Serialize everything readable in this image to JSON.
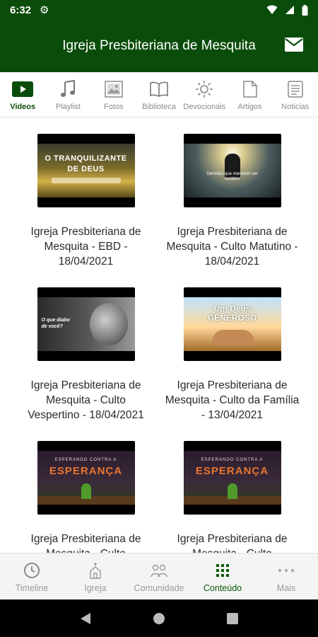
{
  "status_bar": {
    "time": "6:32"
  },
  "app_bar": {
    "title": "Igreja Presbiteriana de Mesquita"
  },
  "tabs": [
    {
      "label": "Videos",
      "icon": "play-icon",
      "active": true
    },
    {
      "label": "Playlist",
      "icon": "music-note-icon",
      "active": false
    },
    {
      "label": "Fotos",
      "icon": "image-icon",
      "active": false
    },
    {
      "label": "Biblioteca",
      "icon": "book-icon",
      "active": false
    },
    {
      "label": "Devocionais",
      "icon": "sun-icon",
      "active": false
    },
    {
      "label": "Artigos",
      "icon": "document-icon",
      "active": false
    },
    {
      "label": "Noticias",
      "icon": "news-icon",
      "active": false
    }
  ],
  "videos": [
    {
      "title": "Igreja Presbiteriana de Mesquita - EBD - 18/04/2021",
      "thumb_text": "O TRANQUILIZANTE DE DEUS"
    },
    {
      "title": "Igreja Presbiteriana de Mesquita - Culto Matutino - 18/04/2021",
      "thumb_text": "Gemidos que merecem ser ouvidos"
    },
    {
      "title": "Igreja Presbiteriana de Mesquita - Culto Vespertino - 18/04/2021",
      "thumb_text": "O que diabo de você?"
    },
    {
      "title": "Igreja Presbiteriana de Mesquita - Culto da Família - 13/04/2021",
      "thumb_text": "Um Deus GENEROSO"
    },
    {
      "title": "Igreja Presbiteriana de Mesquita - Culto",
      "thumb_text_top": "ESPERANDO CONTRA A",
      "thumb_text_big": "ESPERANÇA"
    },
    {
      "title": "Igreja Presbiteriana de Mesquita - Culto",
      "thumb_text_top": "ESPERANDO CONTRA A",
      "thumb_text_big": "ESPERANÇA"
    }
  ],
  "bottom_nav": [
    {
      "label": "Timeline",
      "icon": "clock-icon",
      "active": false
    },
    {
      "label": "Igreja",
      "icon": "church-icon",
      "active": false
    },
    {
      "label": "Comunidade",
      "icon": "people-icon",
      "active": false
    },
    {
      "label": "Conteúdo",
      "icon": "grid-icon",
      "active": true
    },
    {
      "label": "Mais",
      "icon": "more-icon",
      "active": false
    }
  ],
  "colors": {
    "primary": "#0a4d0a",
    "tab_inactive": "#8a8a8a",
    "nav_bg": "#f4f4f4"
  }
}
